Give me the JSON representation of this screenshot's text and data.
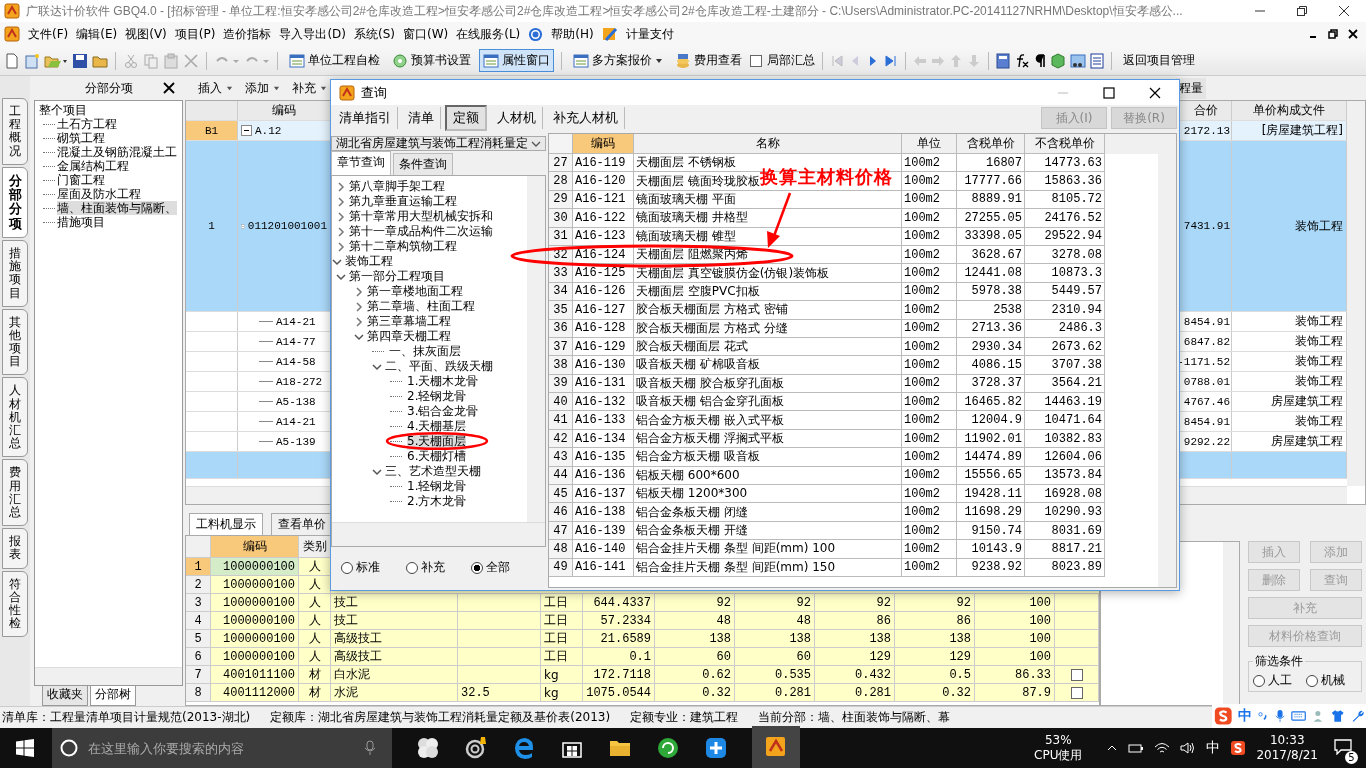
{
  "window": {
    "title": "广联达计价软件 GBQ4.0 - [招标管理 - 单位工程:恒安孝感公司2#仓库改造工程>恒安孝感公司2#仓库改造工程>恒安孝感公司2#仓库改造工程-土建部分 - C:\\Users\\Administrator.PC-20141127NRHM\\Desktop\\恒安孝感公..."
  },
  "menu": [
    "文件(F)",
    "编辑(E)",
    "视图(V)",
    "项目(P)",
    "造价指标",
    "导入导出(D)",
    "系统(S)",
    "窗口(W)",
    "在线服务(L)",
    "帮助(H)",
    "计量支付"
  ],
  "toolbar": {
    "buttons": [
      {
        "label": "单位工程自检",
        "pressed": false
      },
      {
        "label": "预算书设置",
        "pressed": false
      },
      {
        "label": "属性窗口",
        "pressed": true
      },
      {
        "label": "多方案报价",
        "pressed": false
      },
      {
        "label": "费用查看",
        "pressed": false
      }
    ],
    "checkbox": {
      "label": "局部汇总",
      "checked": false
    },
    "return_button": "返回项目管理"
  },
  "side_tabs": [
    {
      "label": "工程概况",
      "selected": false
    },
    {
      "label": "分部分项",
      "selected": true
    },
    {
      "label": "措施项目",
      "selected": false
    },
    {
      "label": "其他项目",
      "selected": false
    },
    {
      "label": "人材机汇总",
      "selected": false
    },
    {
      "label": "费用汇总",
      "selected": false
    },
    {
      "label": "报表",
      "selected": false
    },
    {
      "label": "符合性检",
      "selected": false
    }
  ],
  "section_panel": {
    "title": "分部分项",
    "root": "整个项目",
    "items": [
      {
        "label": "土石方工程",
        "selected": false
      },
      {
        "label": "砌筑工程",
        "selected": false
      },
      {
        "label": "混凝土及钢筋混凝土工",
        "selected": false
      },
      {
        "label": "金属结构工程",
        "selected": false
      },
      {
        "label": "门窗工程",
        "selected": false
      },
      {
        "label": "屋面及防水工程",
        "selected": false
      },
      {
        "label": "墙、柱面装饰与隔断、",
        "selected": true
      },
      {
        "label": "措施项目",
        "selected": false
      }
    ],
    "tabs": [
      {
        "label": "收藏夹",
        "selected": false
      },
      {
        "label": "分部树",
        "selected": true
      }
    ]
  },
  "grid_toolbar": {
    "buttons": [
      "插入",
      "添加",
      "补充"
    ],
    "tab_fragment": "程量"
  },
  "main_table": {
    "columns": {
      "code": "编码",
      "price": "合价",
      "file": "单价构成文件"
    },
    "rows": [
      {
        "kind": "section",
        "num": "B1",
        "code": "A.12",
        "price": "2172.13",
        "file": "[房屋建筑工程]",
        "selected": false
      },
      {
        "kind": "item",
        "num": "1",
        "code": "011201001001",
        "price": "7431.91",
        "file": "装饰工程",
        "selected": true
      },
      {
        "kind": "sub",
        "code": "A14-21",
        "price": "8454.91",
        "file": "装饰工程",
        "selected": false
      },
      {
        "kind": "sub",
        "code": "A14-77",
        "price": "6847.82",
        "file": "装饰工程",
        "selected": false
      },
      {
        "kind": "sub",
        "code": "A14-58",
        "price": "-1171.52",
        "file": "装饰工程",
        "selected": false
      },
      {
        "kind": "sub",
        "code": "A18-272",
        "price": "0788.01",
        "file": "装饰工程",
        "selected": false
      },
      {
        "kind": "sub",
        "code": "A5-138",
        "price": "4767.46",
        "file": "房屋建筑工程",
        "selected": false
      },
      {
        "kind": "sub",
        "code": "A14-21",
        "price": "8454.91",
        "file": "装饰工程",
        "selected": false
      },
      {
        "kind": "sub",
        "code": "A5-139",
        "price": "9292.22",
        "file": "房屋建筑工程",
        "selected": false
      },
      {
        "kind": "blank",
        "selected": true
      }
    ]
  },
  "lower_tabs": [
    {
      "label": "工料机显示",
      "selected": true
    },
    {
      "label": "查看单价",
      "selected": false
    }
  ],
  "resource_table": {
    "columns": {
      "code": "编码",
      "type": "类别"
    },
    "rows": [
      {
        "num": "1",
        "code": "1000000100",
        "type": "人",
        "selected": true
      },
      {
        "num": "2",
        "code": "1000000100",
        "type": "人",
        "selected": false
      },
      {
        "num": "3",
        "code": "1000000100",
        "type": "人",
        "name": "技工",
        "unit": "工日",
        "qty": "644.4337",
        "p1": "92",
        "p2": "92",
        "p3": "92",
        "p4": "92",
        "p5": "100",
        "selected": false
      },
      {
        "num": "4",
        "code": "1000000100",
        "type": "人",
        "name": "技工",
        "unit": "工日",
        "qty": "57.2334",
        "p1": "48",
        "p2": "48",
        "p3": "86",
        "p4": "86",
        "p5": "100",
        "selected": false
      },
      {
        "num": "5",
        "code": "1000000100",
        "type": "人",
        "name": "高级技工",
        "unit": "工日",
        "qty": "21.6589",
        "p1": "138",
        "p2": "138",
        "p3": "138",
        "p4": "138",
        "p5": "100",
        "selected": false
      },
      {
        "num": "6",
        "code": "1000000100",
        "type": "人",
        "name": "高级技工",
        "unit": "工日",
        "qty": "0.1",
        "p1": "60",
        "p2": "60",
        "p3": "129",
        "p4": "129",
        "p5": "100",
        "selected": false
      },
      {
        "num": "7",
        "code": "4001011100",
        "type": "材",
        "name": "白水泥",
        "unit": "kg",
        "qty": "172.7118",
        "p1": "0.62",
        "p2": "0.535",
        "p3": "0.432",
        "p4": "0.5",
        "p5": "86.33",
        "checked": false,
        "selected": false
      },
      {
        "num": "8",
        "code": "4001112000",
        "type": "材",
        "name": "水泥",
        "spec": "32.5",
        "unit": "kg",
        "qty": "1075.0544",
        "p1": "0.32",
        "p2": "0.281",
        "p3": "0.281",
        "p4": "0.32",
        "p5": "87.9",
        "checked": false,
        "selected": false
      }
    ]
  },
  "side_buttons": [
    "插入",
    "添加",
    "删除",
    "查询",
    "补充",
    "材料价格查询"
  ],
  "filter": {
    "title": "筛选条件",
    "options": [
      {
        "label": "人工",
        "selected": false
      },
      {
        "label": "机械",
        "selected": false
      }
    ]
  },
  "dialog": {
    "title": "查询",
    "tabs": [
      {
        "label": "清单指引",
        "selected": false
      },
      {
        "label": "清单",
        "selected": false
      },
      {
        "label": "定额",
        "selected": true
      },
      {
        "label": "人材机",
        "selected": false
      },
      {
        "label": "补充人材机",
        "selected": false
      }
    ],
    "buttons": [
      {
        "label": "插入(I)",
        "disabled": true
      },
      {
        "label": "替换(R)",
        "disabled": true
      }
    ],
    "library": "湖北省房屋建筑与装饰工程消耗量定",
    "query_tabs": [
      {
        "label": "章节查询",
        "selected": true
      },
      {
        "label": "条件查询",
        "selected": false
      }
    ],
    "tree": [
      {
        "children": [
          {
            "label": "第八章脚手架工程",
            "expanded": false,
            "selected": false
          },
          {
            "label": "第九章垂直运输工程",
            "expanded": false,
            "selected": false
          },
          {
            "label": "第十章常用大型机械安拆和",
            "expanded": false,
            "selected": false
          },
          {
            "label": "第十一章成品构件二次运输",
            "expanded": false,
            "selected": false
          },
          {
            "label": "第十二章构筑物工程",
            "expanded": false,
            "selected": false
          }
        ]
      },
      {
        "label": "装饰工程",
        "expanded": true,
        "selected": false,
        "children": [
          {
            "label": "第一部分工程项目",
            "expanded": true,
            "selected": false,
            "children": [
              {
                "label": "第一章楼地面工程",
                "expanded": false,
                "selected": false
              },
              {
                "label": "第二章墙、柱面工程",
                "expanded": false,
                "selected": false
              },
              {
                "label": "第三章幕墙工程",
                "expanded": false,
                "selected": false
              },
              {
                "label": "第四章天棚工程",
                "expanded": true,
                "selected": false,
                "children": [
                  {
                    "label": "一、抹灰面层",
                    "selected": false
                  },
                  {
                    "label": "二、平面、跌级天棚",
                    "expanded": true,
                    "selected": false,
                    "children": [
                      {
                        "label": "1.天棚木龙骨",
                        "selected": false
                      },
                      {
                        "label": "2.轻钢龙骨",
                        "selected": false
                      },
                      {
                        "label": "3.铝合金龙骨",
                        "selected": false
                      },
                      {
                        "label": "4.天棚基层",
                        "selected": false
                      },
                      {
                        "label": "5.天棚面层",
                        "selected": true
                      },
                      {
                        "label": "6.天棚灯槽",
                        "selected": false
                      }
                    ]
                  },
                  {
                    "label": "三、艺术造型天棚",
                    "expanded": true,
                    "selected": false,
                    "children": [
                      {
                        "label": "1.轻钢龙骨",
                        "selected": false
                      },
                      {
                        "label": "2.方木龙骨",
                        "selected": false
                      }
                    ]
                  }
                ]
              }
            ]
          }
        ]
      }
    ],
    "scope": [
      {
        "label": "标准",
        "selected": false
      },
      {
        "label": "补充",
        "selected": false
      },
      {
        "label": "全部",
        "selected": true
      }
    ],
    "table": {
      "columns": [
        "",
        "编码",
        "名称",
        "单位",
        "含税单价",
        "不含税单价"
      ],
      "rows": [
        [
          "27",
          "A16-119",
          "天棚面层 不锈钢板",
          "100m2",
          "16807",
          "14773.63"
        ],
        [
          "28",
          "A16-120",
          "天棚面层 镜面玲珑胶板",
          "100m2",
          "17777.66",
          "15863.36"
        ],
        [
          "29",
          "A16-121",
          "镜面玻璃天棚 平面",
          "100m2",
          "8889.91",
          "8105.72"
        ],
        [
          "30",
          "A16-122",
          "镜面玻璃天棚 井格型",
          "100m2",
          "27255.05",
          "24176.52"
        ],
        [
          "31",
          "A16-123",
          "镜面玻璃天棚 锥型",
          "100m2",
          "33398.05",
          "29522.94"
        ],
        [
          "32",
          "A16-124",
          "天棚面层 阻燃聚丙烯",
          "100m2",
          "3628.67",
          "3278.08"
        ],
        [
          "33",
          "A16-125",
          "天棚面层 真空镀膜仿金(仿银)装饰板",
          "100m2",
          "12441.08",
          "10873.3"
        ],
        [
          "34",
          "A16-126",
          "天棚面层 空腹PVC扣板",
          "100m2",
          "5978.38",
          "5449.57"
        ],
        [
          "35",
          "A16-127",
          "胶合板天棚面层 方格式 密铺",
          "100m2",
          "2538",
          "2310.94"
        ],
        [
          "36",
          "A16-128",
          "胶合板天棚面层 方格式 分缝",
          "100m2",
          "2713.36",
          "2486.3"
        ],
        [
          "37",
          "A16-129",
          "胶合板天棚面层 花式",
          "100m2",
          "2930.34",
          "2673.62"
        ],
        [
          "38",
          "A16-130",
          "吸音板天棚 矿棉吸音板",
          "100m2",
          "4086.15",
          "3707.38"
        ],
        [
          "39",
          "A16-131",
          "吸音板天棚 胶合板穿孔面板",
          "100m2",
          "3728.37",
          "3564.21"
        ],
        [
          "40",
          "A16-132",
          "吸音板天棚 铝合金穿孔面板",
          "100m2",
          "16465.82",
          "14463.19"
        ],
        [
          "41",
          "A16-133",
          "铝合金方板天棚 嵌入式平板",
          "100m2",
          "12004.9",
          "10471.64"
        ],
        [
          "42",
          "A16-134",
          "铝合金方板天棚 浮搁式平板",
          "100m2",
          "11902.01",
          "10382.83"
        ],
        [
          "43",
          "A16-135",
          "铝合金方板天棚 吸音板",
          "100m2",
          "14474.89",
          "12604.06"
        ],
        [
          "44",
          "A16-136",
          "铝板天棚 600*600",
          "100m2",
          "15556.65",
          "13573.84"
        ],
        [
          "45",
          "A16-137",
          "铝板天棚 1200*300",
          "100m2",
          "19428.11",
          "16928.08"
        ],
        [
          "46",
          "A16-138",
          "铝合金条板天棚 闭缝",
          "100m2",
          "11698.29",
          "10290.93"
        ],
        [
          "47",
          "A16-139",
          "铝合金条板天棚 开缝",
          "100m2",
          "9150.74",
          "8031.69"
        ],
        [
          "48",
          "A16-140",
          "铝合金挂片天棚 条型 间距(mm) 100",
          "100m2",
          "10143.9",
          "8817.21"
        ],
        [
          "49",
          "A16-141",
          "铝合金挂片天棚 条型 间距(mm) 150",
          "100m2",
          "9238.92",
          "8023.89"
        ]
      ]
    }
  },
  "annotation": {
    "text": "换算主材料价格"
  },
  "status_bar": [
    "清单库：工程量清单项目计量规范(2013-湖北)",
    "定额库：湖北省房屋建筑与装饰工程消耗量定额及基价表(2013)",
    "定额专业：建筑工程",
    "当前分部：墙、柱面装饰与隔断、幕"
  ],
  "ime_bar": {
    "mode": "中"
  },
  "taskbar": {
    "search_placeholder": "在这里输入你要搜索的内容",
    "cpu_reading": "53%",
    "cpu_label": "CPU使用",
    "input_mode": "中",
    "time": "10:33",
    "date": "2017/8/21",
    "notifications": "5"
  }
}
